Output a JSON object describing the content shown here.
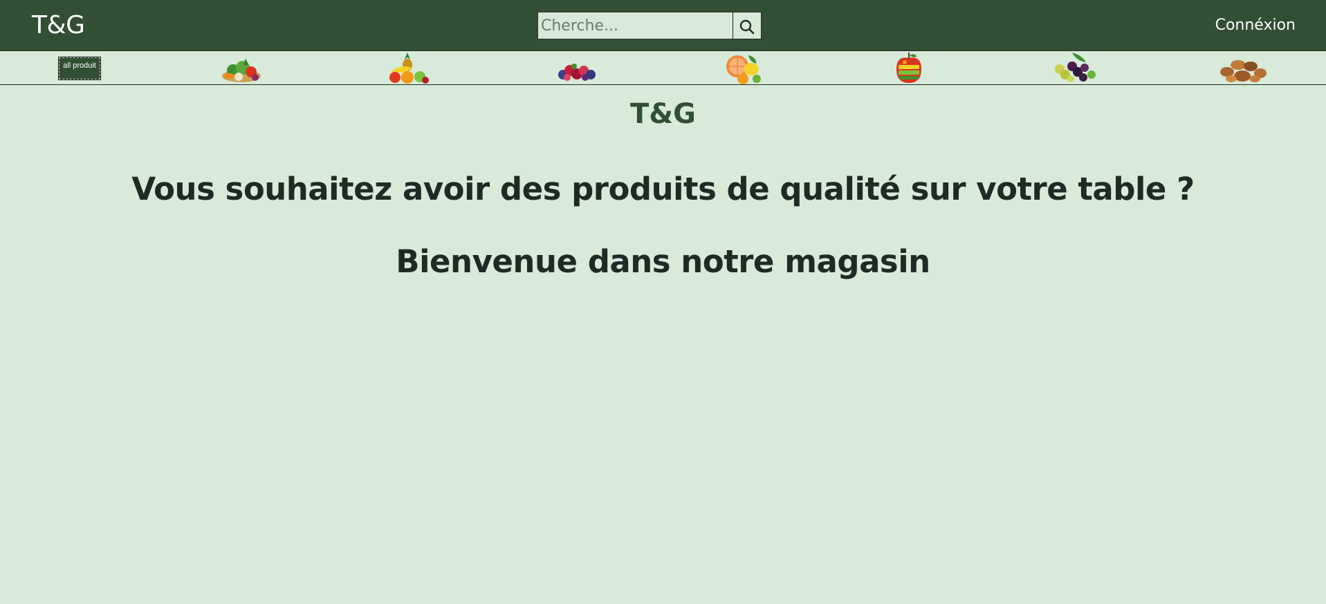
{
  "header": {
    "brand": "T&G",
    "search": {
      "placeholder": "Cherche...",
      "value": ""
    },
    "login_label": "Connéxion"
  },
  "categories": [
    {
      "label": "all produit",
      "icon": "all-products-button"
    },
    {
      "label": "",
      "icon": "vegetables-icon"
    },
    {
      "label": "",
      "icon": "fruits-icon"
    },
    {
      "label": "",
      "icon": "berries-icon"
    },
    {
      "label": "",
      "icon": "citrus-icon"
    },
    {
      "label": "",
      "icon": "apple-fruit-mix-icon"
    },
    {
      "label": "",
      "icon": "grapes-berries-icon"
    },
    {
      "label": "",
      "icon": "nuts-icon"
    }
  ],
  "main": {
    "title": "T&G",
    "headline": "Vous souhaitez avoir des produits de qualité sur votre table ?",
    "welcome": "Bienvenue dans notre magasin"
  },
  "colors": {
    "header_bg": "#324f33",
    "page_bg": "#d8eada",
    "title_color": "#324f33",
    "text_color": "#1f2a25"
  }
}
